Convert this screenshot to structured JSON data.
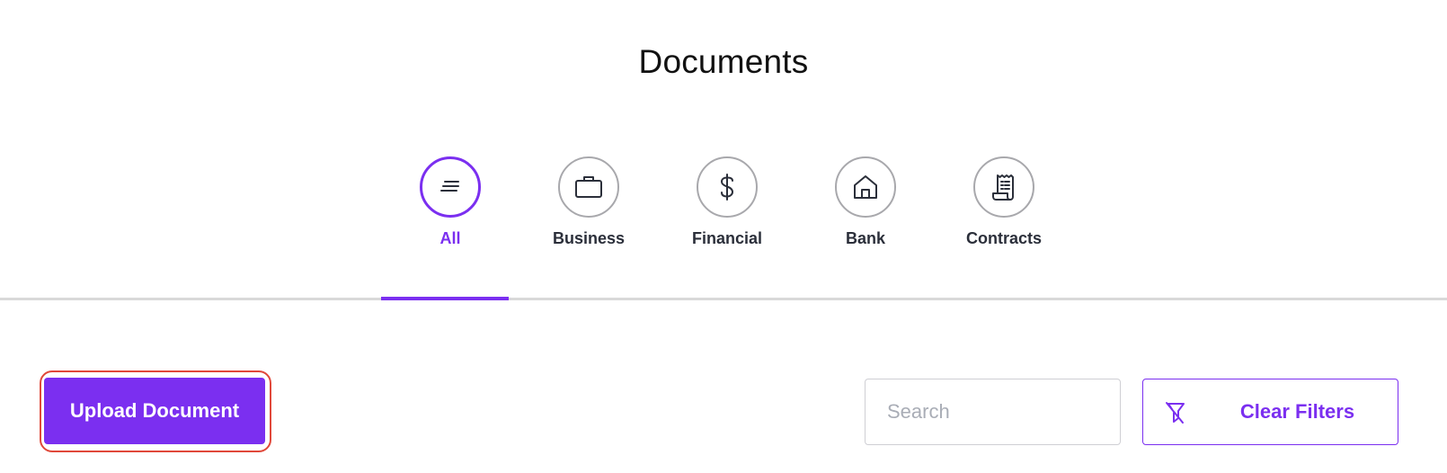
{
  "page": {
    "title": "Documents"
  },
  "tabs": [
    {
      "label": "All",
      "icon": "lines-icon",
      "active": true
    },
    {
      "label": "Business",
      "icon": "briefcase-icon",
      "active": false
    },
    {
      "label": "Financial",
      "icon": "dollar-icon",
      "active": false
    },
    {
      "label": "Bank",
      "icon": "house-icon",
      "active": false
    },
    {
      "label": "Contracts",
      "icon": "receipt-icon",
      "active": false
    }
  ],
  "toolbar": {
    "upload_label": "Upload Document",
    "search_placeholder": "Search",
    "search_value": "",
    "clear_filters_label": "Clear Filters",
    "clear_filters_icon": "filter-off-icon"
  },
  "colors": {
    "accent": "#7b2ff0",
    "highlight": "#e0483a",
    "inactive_border": "#a8a8ac",
    "label_text": "#2b2f3a"
  }
}
